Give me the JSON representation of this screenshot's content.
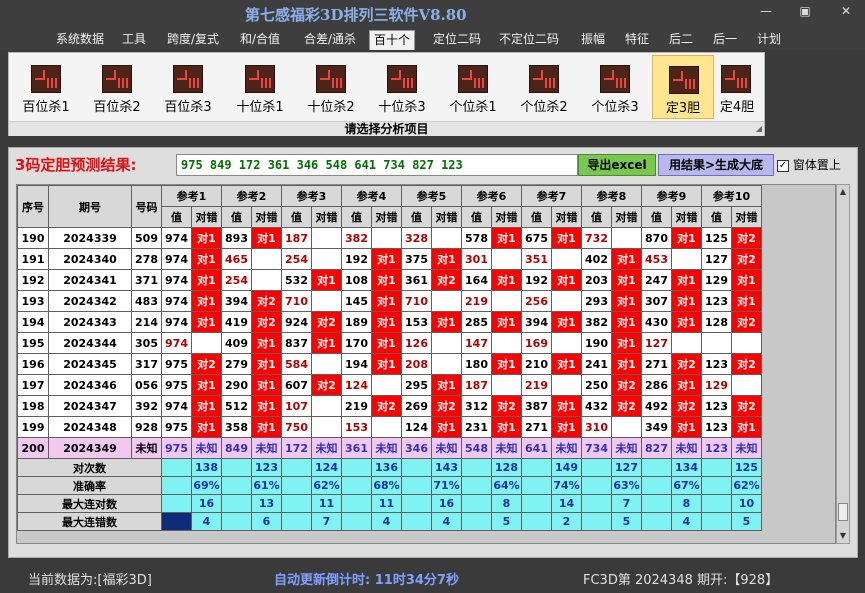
{
  "window": {
    "title": "第七感福彩3D排列三软件V8.80",
    "min_glyph": "—",
    "max_glyph": "▣",
    "close_glyph": "✕"
  },
  "menu": [
    "系统数据",
    "工具",
    "跨度/复式",
    "和/合值",
    "合差/通杀",
    "百十个",
    "定位二码",
    "不定位二码",
    "振幅",
    "特征",
    "后二",
    "后一",
    "计划"
  ],
  "menu_active": 5,
  "ribbon": {
    "buttons": [
      "百位杀1",
      "百位杀2",
      "百位杀3",
      "十位杀1",
      "十位杀2",
      "十位杀3",
      "个位杀1",
      "个位杀2",
      "个位杀3",
      "定3胆",
      "定4胆"
    ],
    "active": 9,
    "caption": "请选择分析项目"
  },
  "result": {
    "label": "3码定胆预测结果:",
    "numbers": "975 849 172 361 346 548 641 734 827 123",
    "export_label": "导出excel",
    "generate_label": "用结果>生成大底",
    "topmost_label": "窗体置上",
    "topmost_checked": true
  },
  "table": {
    "headers": {
      "seq": "序号",
      "period": "期号",
      "code": "号码",
      "value": "值",
      "check": "对错"
    },
    "refs": [
      "参考1",
      "参考2",
      "参考3",
      "参考4",
      "参考5",
      "参考6",
      "参考7",
      "参考8",
      "参考9",
      "参考10"
    ],
    "rows": [
      {
        "seq": "190",
        "period": "2024339",
        "code": "509",
        "refs": [
          [
            "974",
            "对1"
          ],
          [
            "893",
            "对1"
          ],
          [
            "187",
            ""
          ],
          [
            "382",
            ""
          ],
          [
            "328",
            ""
          ],
          [
            "578",
            "对1"
          ],
          [
            "675",
            "对1"
          ],
          [
            "732",
            ""
          ],
          [
            "870",
            "对1"
          ],
          [
            "125",
            "对2"
          ]
        ]
      },
      {
        "seq": "191",
        "period": "2024340",
        "code": "278",
        "refs": [
          [
            "974",
            "对1"
          ],
          [
            "465",
            ""
          ],
          [
            "254",
            ""
          ],
          [
            "192",
            "对1"
          ],
          [
            "375",
            "对1"
          ],
          [
            "301",
            ""
          ],
          [
            "351",
            ""
          ],
          [
            "402",
            "对1"
          ],
          [
            "453",
            ""
          ],
          [
            "127",
            "对2"
          ]
        ]
      },
      {
        "seq": "192",
        "period": "2024341",
        "code": "371",
        "refs": [
          [
            "974",
            "对1"
          ],
          [
            "254",
            ""
          ],
          [
            "532",
            "对1"
          ],
          [
            "108",
            "对1"
          ],
          [
            "361",
            "对2"
          ],
          [
            "164",
            "对1"
          ],
          [
            "192",
            "对1"
          ],
          [
            "203",
            "对1"
          ],
          [
            "247",
            "对1"
          ],
          [
            "129",
            "对1"
          ]
        ]
      },
      {
        "seq": "193",
        "period": "2024342",
        "code": "483",
        "refs": [
          [
            "974",
            "对1"
          ],
          [
            "394",
            "对2"
          ],
          [
            "710",
            ""
          ],
          [
            "145",
            "对1"
          ],
          [
            "710",
            ""
          ],
          [
            "219",
            ""
          ],
          [
            "256",
            ""
          ],
          [
            "293",
            "对1"
          ],
          [
            "307",
            "对1"
          ],
          [
            "123",
            "对1"
          ]
        ]
      },
      {
        "seq": "194",
        "period": "2024343",
        "code": "214",
        "refs": [
          [
            "974",
            "对1"
          ],
          [
            "419",
            "对2"
          ],
          [
            "924",
            "对2"
          ],
          [
            "189",
            "对1"
          ],
          [
            "153",
            "对1"
          ],
          [
            "285",
            "对1"
          ],
          [
            "394",
            "对1"
          ],
          [
            "382",
            "对1"
          ],
          [
            "430",
            "对1"
          ],
          [
            "128",
            "对2"
          ]
        ]
      },
      {
        "seq": "195",
        "period": "2024344",
        "code": "305",
        "refs": [
          [
            "974",
            ""
          ],
          [
            "409",
            "对1"
          ],
          [
            "837",
            "对1"
          ],
          [
            "170",
            "对1"
          ],
          [
            "126",
            ""
          ],
          [
            "147",
            ""
          ],
          [
            "169",
            ""
          ],
          [
            "190",
            "对1"
          ],
          [
            "127",
            ""
          ],
          [
            "",
            ""
          ]
        ]
      },
      {
        "seq": "196",
        "period": "2024345",
        "code": "317",
        "refs": [
          [
            "975",
            "对2"
          ],
          [
            "279",
            "对1"
          ],
          [
            "584",
            ""
          ],
          [
            "194",
            "对1"
          ],
          [
            "208",
            ""
          ],
          [
            "180",
            "对1"
          ],
          [
            "210",
            "对1"
          ],
          [
            "241",
            "对1"
          ],
          [
            "271",
            "对2"
          ],
          [
            "123",
            "对2"
          ]
        ]
      },
      {
        "seq": "197",
        "period": "2024346",
        "code": "056",
        "refs": [
          [
            "975",
            "对1"
          ],
          [
            "290",
            "对1"
          ],
          [
            "607",
            "对2"
          ],
          [
            "124",
            ""
          ],
          [
            "295",
            "对1"
          ],
          [
            "187",
            ""
          ],
          [
            "219",
            ""
          ],
          [
            "250",
            "对2"
          ],
          [
            "286",
            "对1"
          ],
          [
            "129",
            ""
          ]
        ]
      },
      {
        "seq": "198",
        "period": "2024347",
        "code": "392",
        "refs": [
          [
            "974",
            "对1"
          ],
          [
            "512",
            "对1"
          ],
          [
            "107",
            ""
          ],
          [
            "219",
            "对2"
          ],
          [
            "269",
            "对2"
          ],
          [
            "312",
            "对2"
          ],
          [
            "387",
            "对1"
          ],
          [
            "432",
            "对2"
          ],
          [
            "492",
            "对2"
          ],
          [
            "123",
            "对2"
          ]
        ]
      },
      {
        "seq": "199",
        "period": "2024348",
        "code": "928",
        "refs": [
          [
            "975",
            "对1"
          ],
          [
            "358",
            "对1"
          ],
          [
            "750",
            ""
          ],
          [
            "153",
            ""
          ],
          [
            "124",
            "对1"
          ],
          [
            "231",
            "对1"
          ],
          [
            "271",
            "对1"
          ],
          [
            "310",
            ""
          ],
          [
            "349",
            "对1"
          ],
          [
            "123",
            "对1"
          ]
        ]
      }
    ],
    "pending": {
      "seq": "200",
      "period": "2024349",
      "code": "未知",
      "refs": [
        [
          "975",
          "未知"
        ],
        [
          "849",
          "未知"
        ],
        [
          "172",
          "未知"
        ],
        [
          "361",
          "未知"
        ],
        [
          "346",
          "未知"
        ],
        [
          "548",
          "未知"
        ],
        [
          "641",
          "未知"
        ],
        [
          "734",
          "未知"
        ],
        [
          "827",
          "未知"
        ],
        [
          "123",
          "未知"
        ]
      ]
    },
    "stats": [
      {
        "label": "对次数",
        "values": [
          "138",
          "123",
          "124",
          "136",
          "143",
          "128",
          "149",
          "127",
          "134",
          "125"
        ]
      },
      {
        "label": "准确率",
        "values": [
          "69%",
          "61%",
          "62%",
          "68%",
          "71%",
          "64%",
          "74%",
          "63%",
          "67%",
          "62%"
        ]
      },
      {
        "label": "最大连对数",
        "values": [
          "16",
          "13",
          "11",
          "11",
          "16",
          "8",
          "14",
          "7",
          "8",
          "10"
        ]
      },
      {
        "label": "最大连错数",
        "values": [
          "4",
          "6",
          "7",
          "4",
          "4",
          "5",
          "2",
          "5",
          "4",
          "5"
        ]
      }
    ]
  },
  "status": {
    "left": "当前数据为:[福彩3D]",
    "middle": "自动更新倒计时:  11时34分7秒",
    "right": "FC3D第 2024348 期开:【928】"
  }
}
